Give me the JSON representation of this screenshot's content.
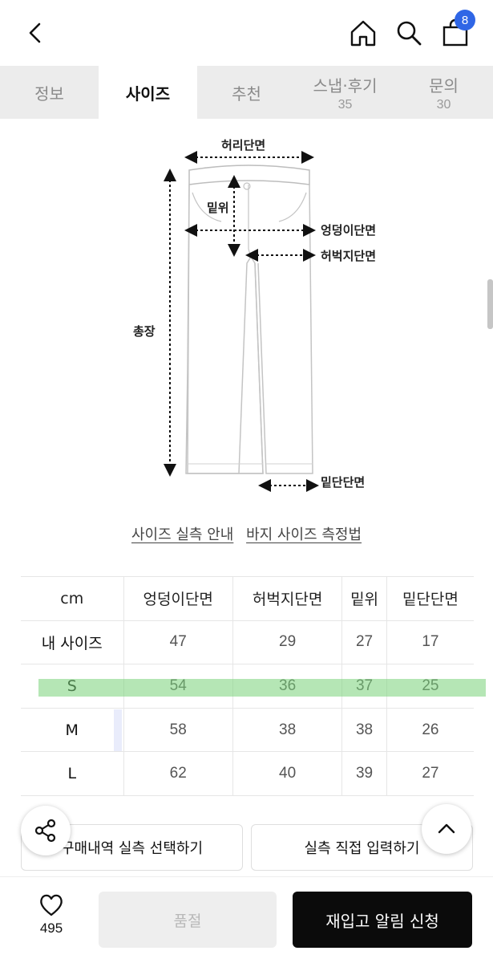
{
  "header": {
    "back_icon": "chevron-left-icon",
    "home_icon": "home-icon",
    "search_icon": "search-icon",
    "cart_icon": "shopping-bag-icon",
    "cart_badge": "8",
    "badge_color": "#2f66e6"
  },
  "tabs": [
    {
      "label": "정보",
      "count": ""
    },
    {
      "label": "사이즈",
      "count": ""
    },
    {
      "label": "추천",
      "count": ""
    },
    {
      "label": "스냅·후기",
      "count": "35"
    },
    {
      "label": "문의",
      "count": "30"
    }
  ],
  "active_tab": "사이즈",
  "diagram": {
    "waist": "허리단면",
    "rise": "밑위",
    "hip": "엉덩이단면",
    "thigh": "허벅지단면",
    "length": "총장",
    "hem": "밑단단면"
  },
  "links": {
    "guide": "사이즈 실측 안내",
    "method": "바지 사이즈 측정법"
  },
  "table": {
    "headers": [
      "cm",
      "엉덩이단면",
      "허벅지단면",
      "밑위",
      "밑단단면"
    ],
    "rows": [
      {
        "label": "내 사이즈",
        "values": [
          "47",
          "29",
          "27",
          "17"
        ]
      },
      {
        "label": "S",
        "values": [
          "54",
          "36",
          "37",
          "25"
        ]
      },
      {
        "label": "M",
        "values": [
          "58",
          "38",
          "38",
          "26"
        ]
      },
      {
        "label": "L",
        "values": [
          "62",
          "40",
          "39",
          "27"
        ]
      }
    ],
    "highlighted_row": "S",
    "highlight_color": "#78d278"
  },
  "actions": {
    "purchase_history": "구매내역 실측 선택하기",
    "direct_input": "실측 직접 입력하기",
    "share_icon": "share-icon",
    "scroll_top_icon": "chevron-up-icon"
  },
  "bottom_bar": {
    "heart_icon": "heart-icon",
    "like_count": "495",
    "soldout_label": "품절",
    "restock_label": "재입고 알림 신청"
  }
}
